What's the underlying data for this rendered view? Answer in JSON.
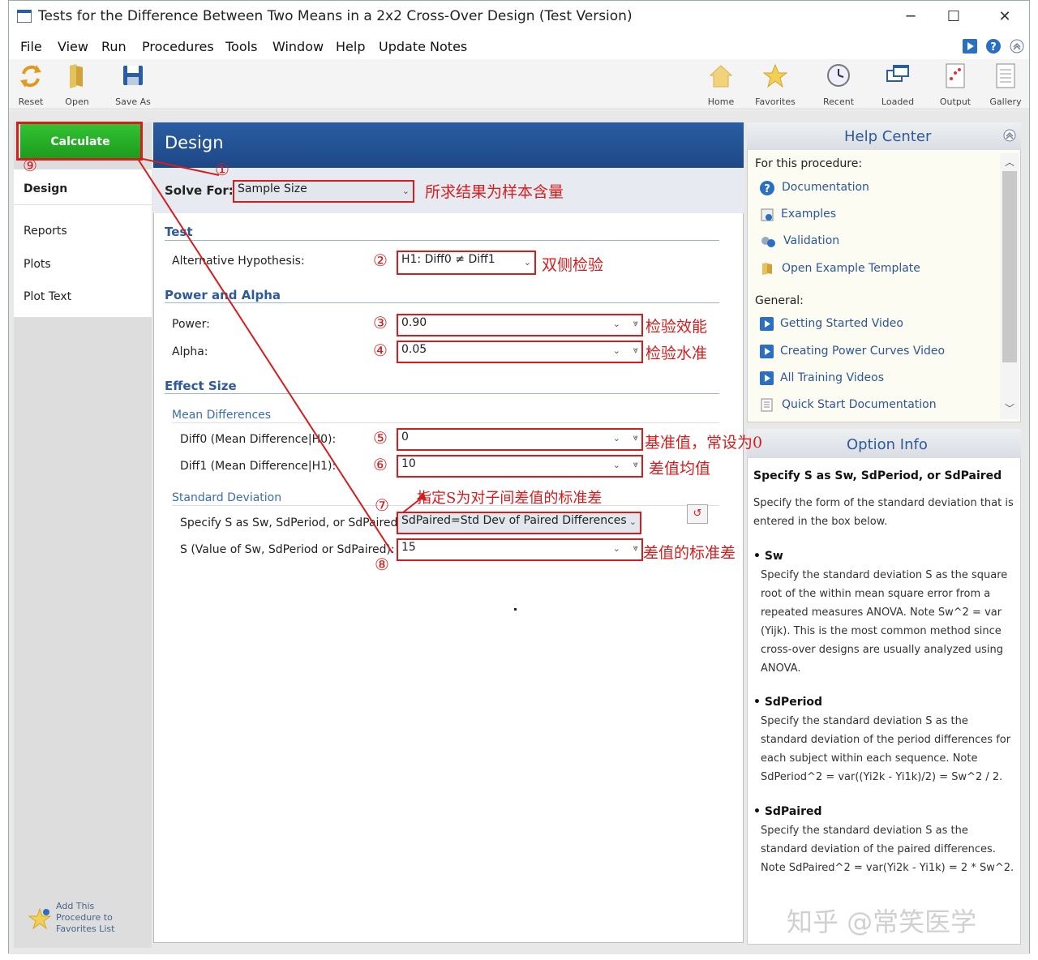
{
  "window": {
    "title": "Tests for the Difference Between Two Means in a 2x2 Cross-Over Design (Test Version)",
    "minimize": "─",
    "maximize": "☐",
    "close": "✕"
  },
  "menu": [
    "File",
    "View",
    "Run",
    "Procedures",
    "Tools",
    "Window",
    "Help",
    "Update Notes"
  ],
  "toolbar": {
    "left": [
      {
        "label": "Reset",
        "icon": "reset-icon"
      },
      {
        "label": "Open",
        "icon": "open-icon"
      },
      {
        "label": "Save As",
        "icon": "save-icon"
      }
    ],
    "right": [
      {
        "label": "Home",
        "icon": "home-icon"
      },
      {
        "label": "Favorites",
        "icon": "star-icon"
      },
      {
        "label": "Recent",
        "icon": "clock-icon"
      },
      {
        "label": "Loaded",
        "icon": "loaded-icon"
      },
      {
        "label": "Output",
        "icon": "output-icon"
      },
      {
        "label": "Gallery",
        "icon": "gallery-icon"
      }
    ]
  },
  "nav": {
    "calculate": "Calculate",
    "items": [
      "Design",
      "Reports",
      "Plots",
      "Plot Text"
    ],
    "active": "Design",
    "favorites": "Add This Procedure to Favorites List"
  },
  "design": {
    "title": "Design",
    "solve_for_label": "Solve For:",
    "solve_for_value": "Sample Size",
    "test_section": "Test",
    "alt_hyp_label": "Alternative Hypothesis:",
    "alt_hyp_value": "H1: Diff0 ≠ Diff1",
    "power_alpha_section": "Power and Alpha",
    "power_label": "Power:",
    "power_value": "0.90",
    "alpha_label": "Alpha:",
    "alpha_value": "0.05",
    "effect_section": "Effect Size",
    "mean_diff_sub": "Mean Differences",
    "diff0_label": "Diff0 (Mean Difference|H0):",
    "diff0_value": "0",
    "diff1_label": "Diff1 (Mean Difference|H1):",
    "diff1_value": "10",
    "sd_sub": "Standard Deviation",
    "specify_s_label": "Specify S as Sw, SdPeriod, or SdPaired:",
    "specify_s_value": "SdPaired=Std Dev of Paired Differences",
    "s_label": "S (Value of Sw, SdPeriod or SdPaired):",
    "s_value": "15"
  },
  "annotations": {
    "n1": "①",
    "n2": "②",
    "n3": "③",
    "n4": "④",
    "n5": "⑤",
    "n6": "⑥",
    "n7": "⑦",
    "n8": "⑧",
    "n9": "⑨",
    "a1": "所求结果为样本含量",
    "a2": "双侧检验",
    "a3": "检验效能",
    "a4": "检验水准",
    "a5": "基准值，常设为0",
    "a6": "差值均值",
    "a7": "指定S为对子间差值的标准差",
    "a8": "差值的标准差"
  },
  "help": {
    "title": "Help Center",
    "procedure_heading": "For this procedure:",
    "procedure_links": [
      "Documentation",
      "Examples",
      "Validation",
      "Open Example Template"
    ],
    "general_heading": "General:",
    "general_links": [
      "Getting Started Video",
      "Creating Power Curves Video",
      "All Training Videos",
      "Quick Start Documentation"
    ]
  },
  "option_info": {
    "title": "Option Info",
    "heading": "Specify S as Sw, SdPeriod, or SdPaired",
    "intro": "Specify the form of the standard deviation that is entered in the box below.",
    "items": [
      {
        "name": "Sw",
        "text": "Specify the standard deviation S as the square root of the within mean square error from a repeated measures ANOVA. Note Sw^2 = var (Yijk). This is the most common method since cross-over designs are usually analyzed using ANOVA."
      },
      {
        "name": "SdPeriod",
        "text": "Specify the standard deviation S as the standard deviation of the period differences for each subject within each sequence. Note SdPeriod^2 = var((Yi2k - Yi1k)/2) = Sw^2 / 2."
      },
      {
        "name": "SdPaired",
        "text": "Specify the standard deviation S as the standard deviation of the paired differences. Note SdPaired^2 = var(Yi2k - Yi1k) = 2 * Sw^2."
      }
    ]
  },
  "watermark": "知乎 @常笑医学",
  "colors": {
    "accent": "#2e5a99",
    "annotation": "#d21e1e",
    "calculate": "#1fa51f",
    "header": "#1d4886"
  }
}
